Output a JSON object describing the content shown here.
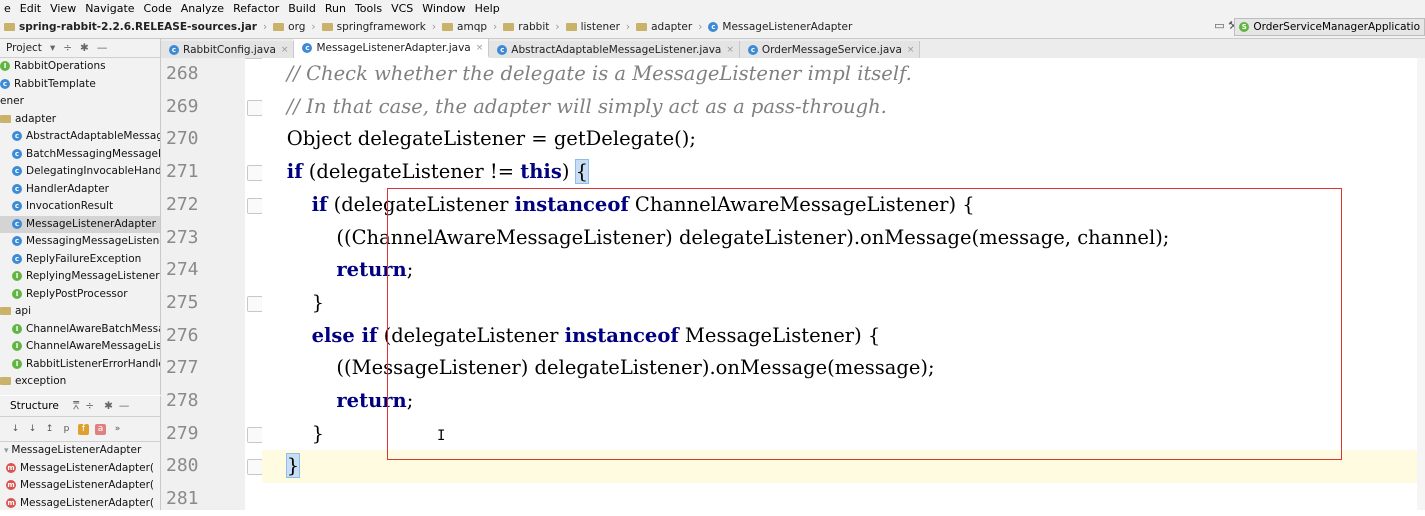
{
  "menu": [
    "e",
    "Edit",
    "View",
    "Navigate",
    "Code",
    "Analyze",
    "Refactor",
    "Build",
    "Run",
    "Tools",
    "VCS",
    "Window",
    "Help"
  ],
  "breadcrumb": [
    "spring-rabbit-2.2.6.RELEASE-sources.jar",
    "org",
    "springframework",
    "amqp",
    "rabbit",
    "listener",
    "adapter",
    "MessageListenerAdapter"
  ],
  "run_config": "OrderServiceManagerApplicatio",
  "project_panel": {
    "title": "Project",
    "items": [
      {
        "label": "RabbitOperations",
        "icon": "interface-icon",
        "indent": 0
      },
      {
        "label": "RabbitTemplate",
        "icon": "class-icon",
        "indent": 0
      },
      {
        "label": "ener",
        "icon": "",
        "indent": 0
      },
      {
        "label": "adapter",
        "icon": "folder-icon",
        "indent": 0
      },
      {
        "label": "AbstractAdaptableMessage",
        "icon": "class-icon",
        "indent": 1
      },
      {
        "label": "BatchMessagingMessageLis",
        "icon": "class-icon",
        "indent": 1
      },
      {
        "label": "DelegatingInvocableHandle",
        "icon": "class-icon",
        "indent": 1
      },
      {
        "label": "HandlerAdapter",
        "icon": "class-icon",
        "indent": 1
      },
      {
        "label": "InvocationResult",
        "icon": "class-icon",
        "indent": 1
      },
      {
        "label": "MessageListenerAdapter",
        "icon": "class-icon",
        "indent": 1,
        "selected": true
      },
      {
        "label": "MessagingMessageListener",
        "icon": "class-icon",
        "indent": 1
      },
      {
        "label": "ReplyFailureException",
        "icon": "class-icon",
        "indent": 1
      },
      {
        "label": "ReplyingMessageListener",
        "icon": "interface-icon",
        "indent": 1
      },
      {
        "label": "ReplyPostProcessor",
        "icon": "interface-icon",
        "indent": 1
      },
      {
        "label": "api",
        "icon": "folder-icon",
        "indent": 0
      },
      {
        "label": "ChannelAwareBatchMessag",
        "icon": "interface-icon",
        "indent": 1
      },
      {
        "label": "ChannelAwareMessageListe",
        "icon": "interface-icon",
        "indent": 1
      },
      {
        "label": "RabbitListenerErrorHandler",
        "icon": "interface-icon",
        "indent": 1
      },
      {
        "label": "exception",
        "icon": "folder-icon",
        "indent": 0
      }
    ]
  },
  "structure_panel": {
    "title": "Structure",
    "root": "MessageListenerAdapter",
    "items": [
      "MessageListenerAdapter(",
      "MessageListenerAdapter(",
      "MessageListenerAdapter("
    ]
  },
  "tabs": [
    {
      "label": "RabbitConfig.java",
      "active": false
    },
    {
      "label": "MessageListenerAdapter.java",
      "active": true
    },
    {
      "label": "AbstractAdaptableMessageListener.java",
      "active": false
    },
    {
      "label": "OrderMessageService.java",
      "active": false
    }
  ],
  "editor": {
    "line_numbers": [
      "268",
      "269",
      "270",
      "271",
      "272",
      "273",
      "274",
      "275",
      "276",
      "277",
      "278",
      "279",
      "280",
      "281"
    ],
    "lines": [
      [
        {
          "t": "    "
        },
        {
          "t": "// Check whether the delegate is a MessageListener impl itself.",
          "c": "cmt"
        }
      ],
      [
        {
          "t": "    "
        },
        {
          "t": "// In that case, the adapter will simply act as a pass-through.",
          "c": "cmt"
        }
      ],
      [
        {
          "t": "    Object delegateListener = getDelegate();"
        }
      ],
      [
        {
          "t": "    "
        },
        {
          "t": "if",
          "c": "kw"
        },
        {
          "t": " (delegateListener != "
        },
        {
          "t": "this",
          "c": "kw"
        },
        {
          "t": ") "
        },
        {
          "t": "{",
          "c": "brace-match"
        }
      ],
      [
        {
          "t": "        "
        },
        {
          "t": "if",
          "c": "kw"
        },
        {
          "t": " (delegateListener "
        },
        {
          "t": "instanceof",
          "c": "kw"
        },
        {
          "t": " ChannelAwareMessageListener) {"
        }
      ],
      [
        {
          "t": "            ((ChannelAwareMessageListener) delegateListener).onMessage(message, channel);"
        }
      ],
      [
        {
          "t": "            "
        },
        {
          "t": "return",
          "c": "kw"
        },
        {
          "t": ";"
        }
      ],
      [
        {
          "t": "        }"
        }
      ],
      [
        {
          "t": "        "
        },
        {
          "t": "else if",
          "c": "kw"
        },
        {
          "t": " (delegateListener "
        },
        {
          "t": "instanceof",
          "c": "kw"
        },
        {
          "t": " MessageListener) {"
        }
      ],
      [
        {
          "t": "            ((MessageListener) delegateListener).onMessage(message);"
        }
      ],
      [
        {
          "t": "            "
        },
        {
          "t": "return",
          "c": "kw"
        },
        {
          "t": ";"
        }
      ],
      [
        {
          "t": "        }"
        }
      ],
      [
        {
          "t": "    "
        },
        {
          "t": "}",
          "c": "brace-match"
        }
      ],
      [
        {
          "t": ""
        }
      ]
    ]
  }
}
